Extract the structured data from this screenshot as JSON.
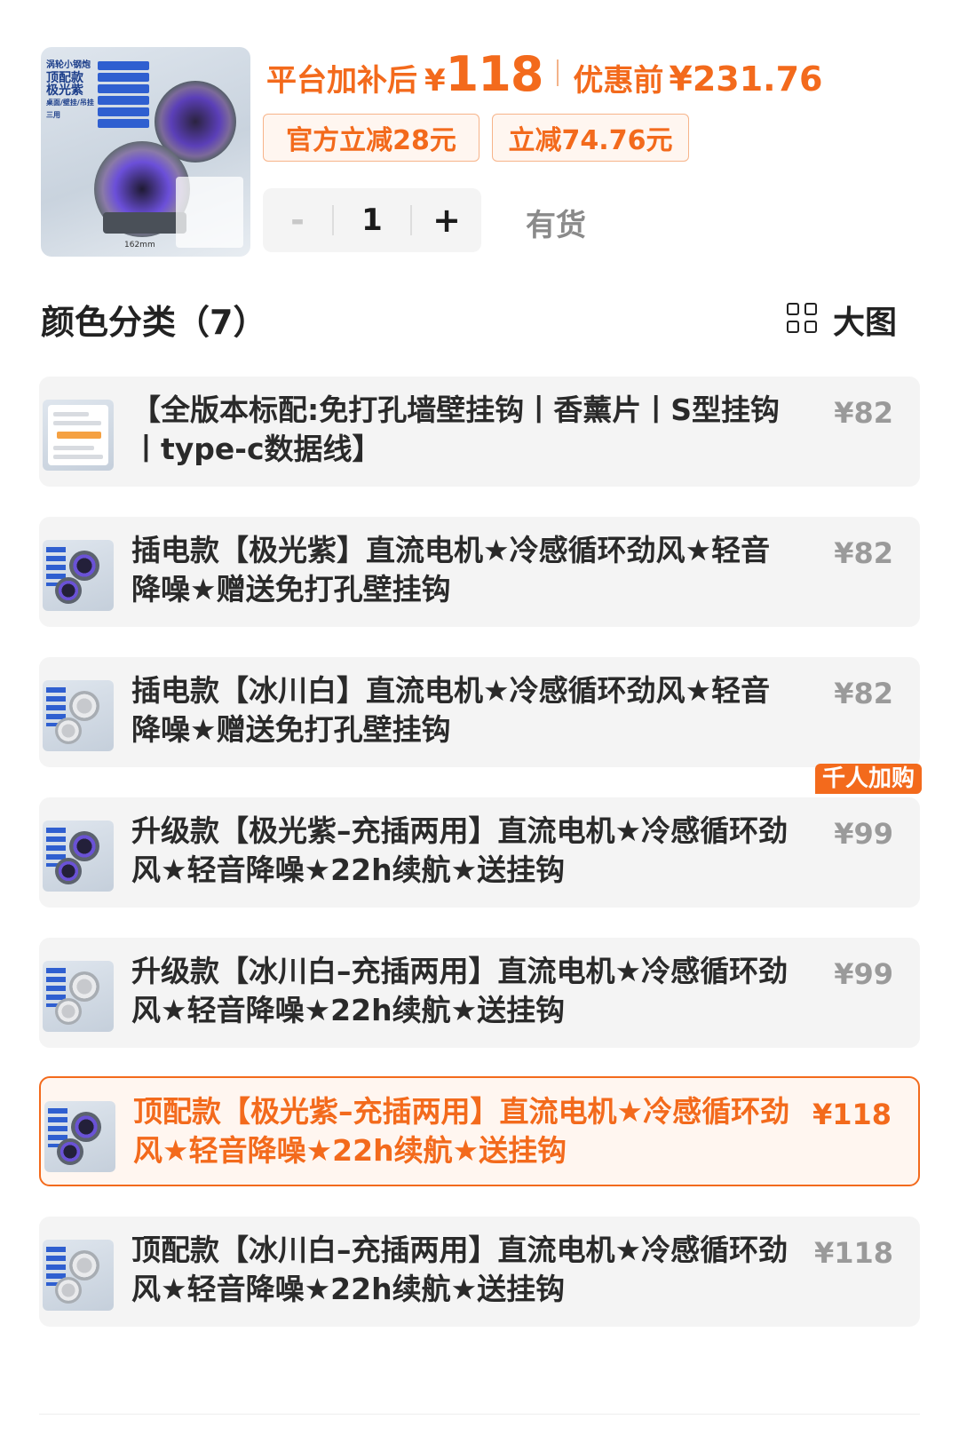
{
  "product": {
    "image": {
      "panel_lines": [
        "涡轮小钢炮",
        "顶配款",
        "极光紫",
        "桌面/壁挂/吊挂三用"
      ],
      "dimension_label": "162mm"
    },
    "price_label": "平台加补后",
    "price_currency": "¥",
    "price_amount": "118",
    "original_label": "优惠前",
    "original_price": "¥231.76",
    "coupons": [
      "官方立减28元",
      "立减74.76元"
    ],
    "quantity": {
      "minus": "-",
      "value": "1",
      "plus": "+"
    },
    "stock_status": "有货"
  },
  "section": {
    "title": "颜色分类（7）",
    "view_toggle_label": "大图",
    "view_toggle_icon": "grid-icon"
  },
  "variants": [
    {
      "label": "【全版本标配:免打孔墙壁挂钩丨香薰片丨S型挂钩丨type-c数据线】",
      "price": "¥82",
      "thumb": "accessory-doc"
    },
    {
      "label": "插电款【极光紫】直流电机★冷感循环劲风★轻音降噪★赠送免打孔壁挂钩",
      "price": "¥82",
      "thumb": "purple"
    },
    {
      "label": "插电款【冰川白】直流电机★冷感循环劲风★轻音降噪★赠送免打孔壁挂钩",
      "price": "¥82",
      "thumb": "white"
    },
    {
      "label": "升级款【极光紫–充插两用】直流电机★冷感循环劲风★轻音降噪★22h续航★送挂钩",
      "price": "¥99",
      "badge": "千人加购",
      "thumb": "purple"
    },
    {
      "label": "升级款【冰川白–充插两用】直流电机★冷感循环劲风★轻音降噪★22h续航★送挂钩",
      "price": "¥99",
      "thumb": "white"
    },
    {
      "label": "顶配款【极光紫–充插两用】直流电机★冷感循环劲风★轻音降噪★22h续航★送挂钩",
      "price": "¥118",
      "selected": true,
      "thumb": "purple"
    },
    {
      "label": "顶配款【冰川白–充插两用】直流电机★冷感循环劲风★轻音降噪★22h续航★送挂钩",
      "price": "¥118",
      "thumb": "white"
    }
  ],
  "colors": {
    "accent": "#f36a1c",
    "card_bg": "#f4f4f4",
    "muted_price": "#9a9a9a"
  }
}
